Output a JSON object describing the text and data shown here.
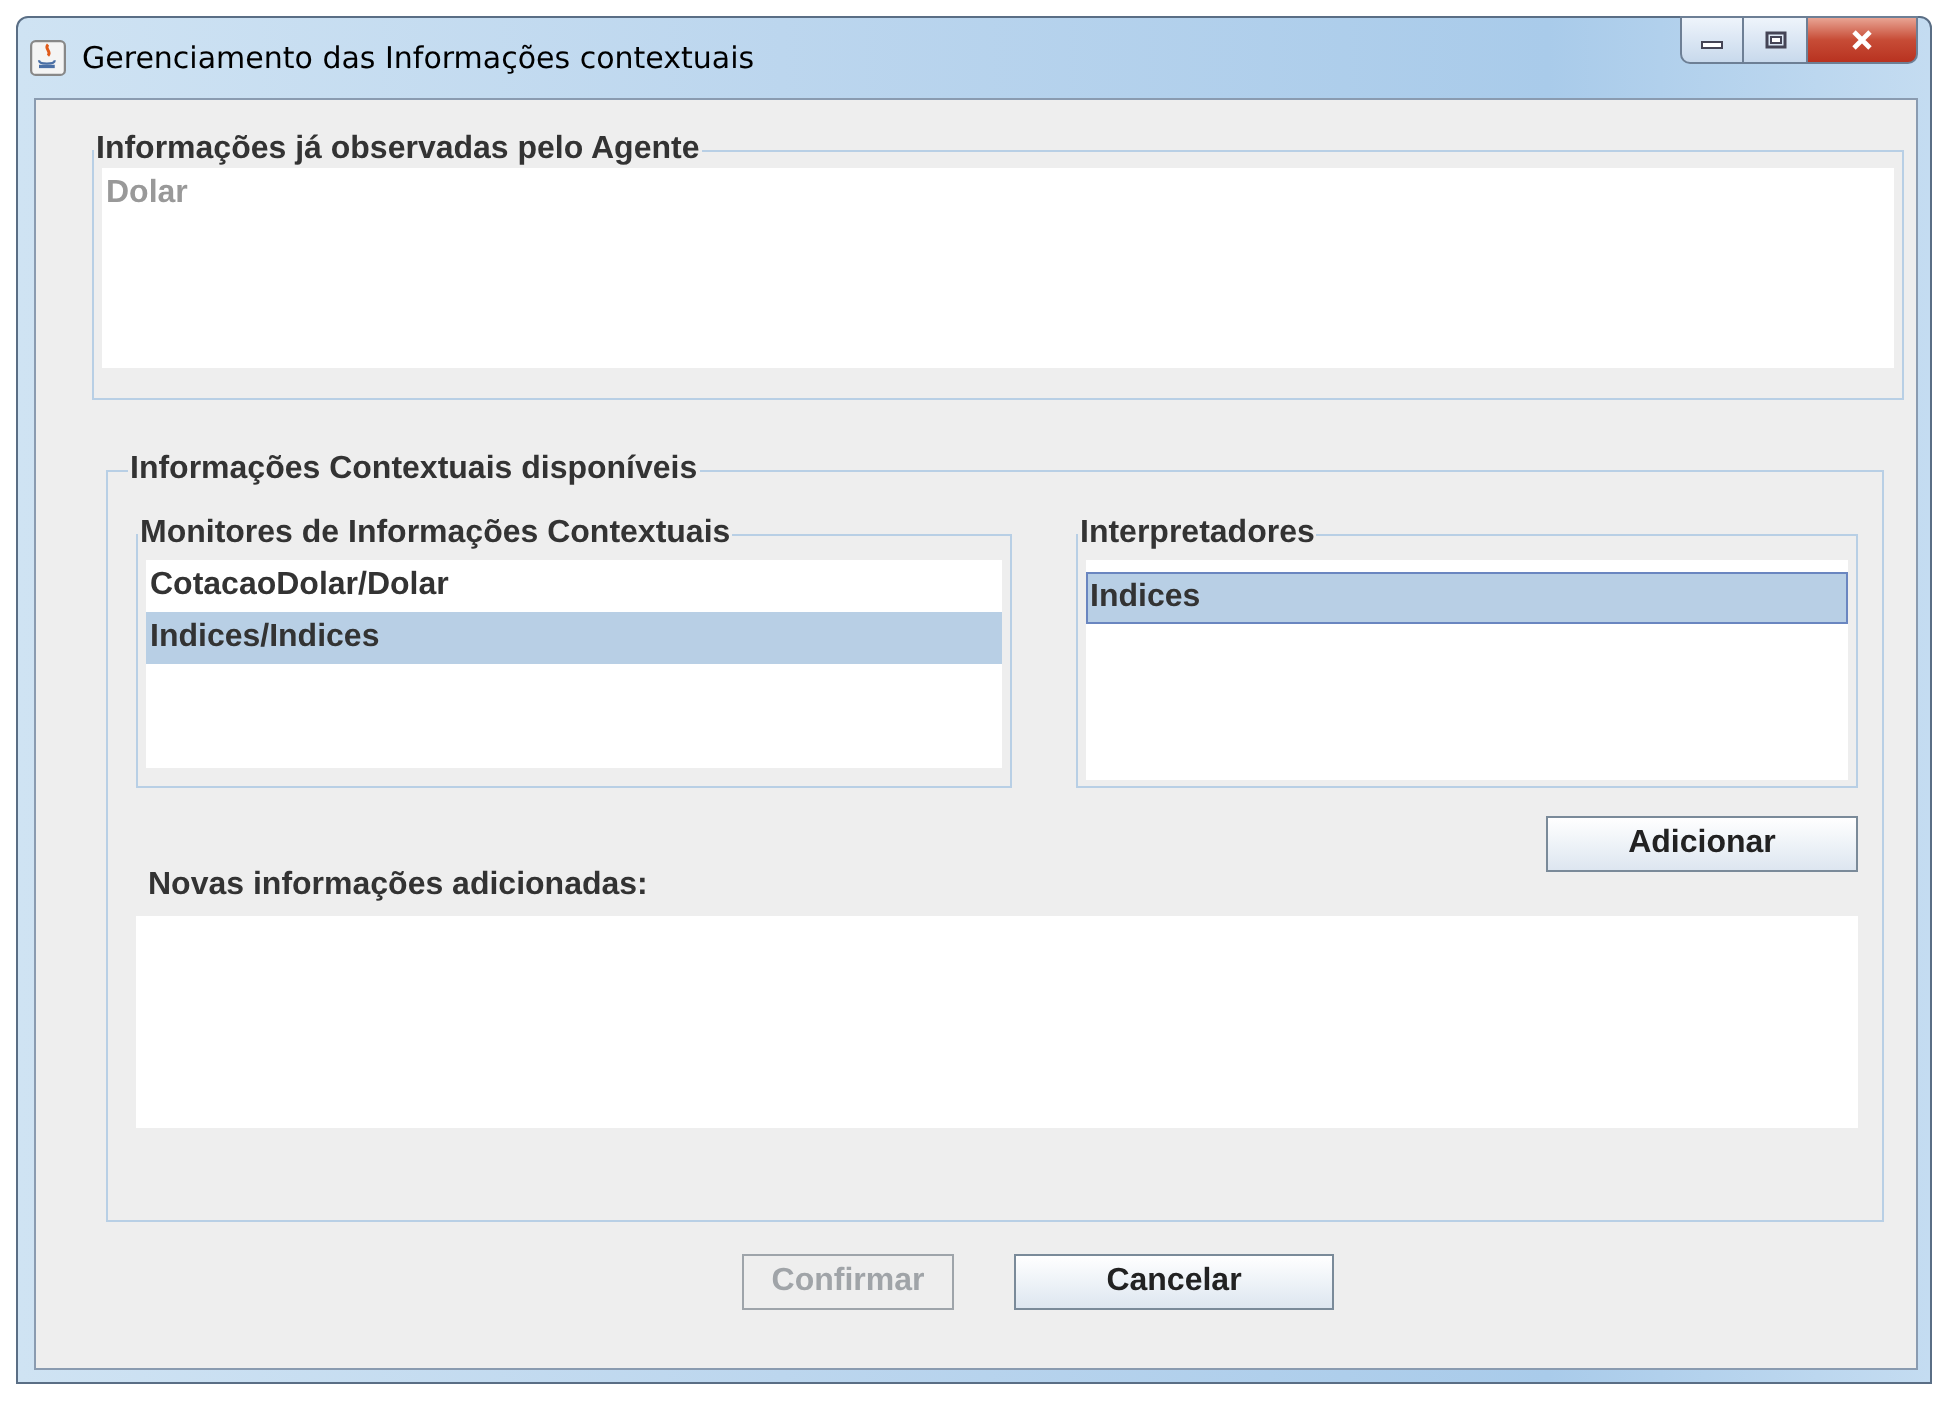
{
  "window": {
    "title": "Gerenciamento das Informações contextuais",
    "controls": [
      {
        "kind": "minimize"
      },
      {
        "kind": "maximize"
      },
      {
        "kind": "close"
      }
    ]
  },
  "observed": {
    "title": "Informações já observadas pelo Agente",
    "items": [
      {
        "label": "Dolar",
        "disabled": true
      }
    ]
  },
  "available": {
    "title": "Informações Contextuais disponíveis",
    "monitors": {
      "title": "Monitores de Informações Contextuais",
      "items": [
        {
          "label": "CotacaoDolar/Dolar",
          "selected": false
        },
        {
          "label": "Indices/Indices",
          "selected": true
        }
      ]
    },
    "interpreters": {
      "title": "Interpretadores",
      "items": [
        {
          "label": "Indices",
          "selected": true
        }
      ]
    },
    "add_button": "Adicionar",
    "new_label": "Novas informações adicionadas:"
  },
  "buttons": [
    {
      "label": "Confirmar",
      "disabled": true
    },
    {
      "label": "Cancelar",
      "disabled": false
    }
  ]
}
